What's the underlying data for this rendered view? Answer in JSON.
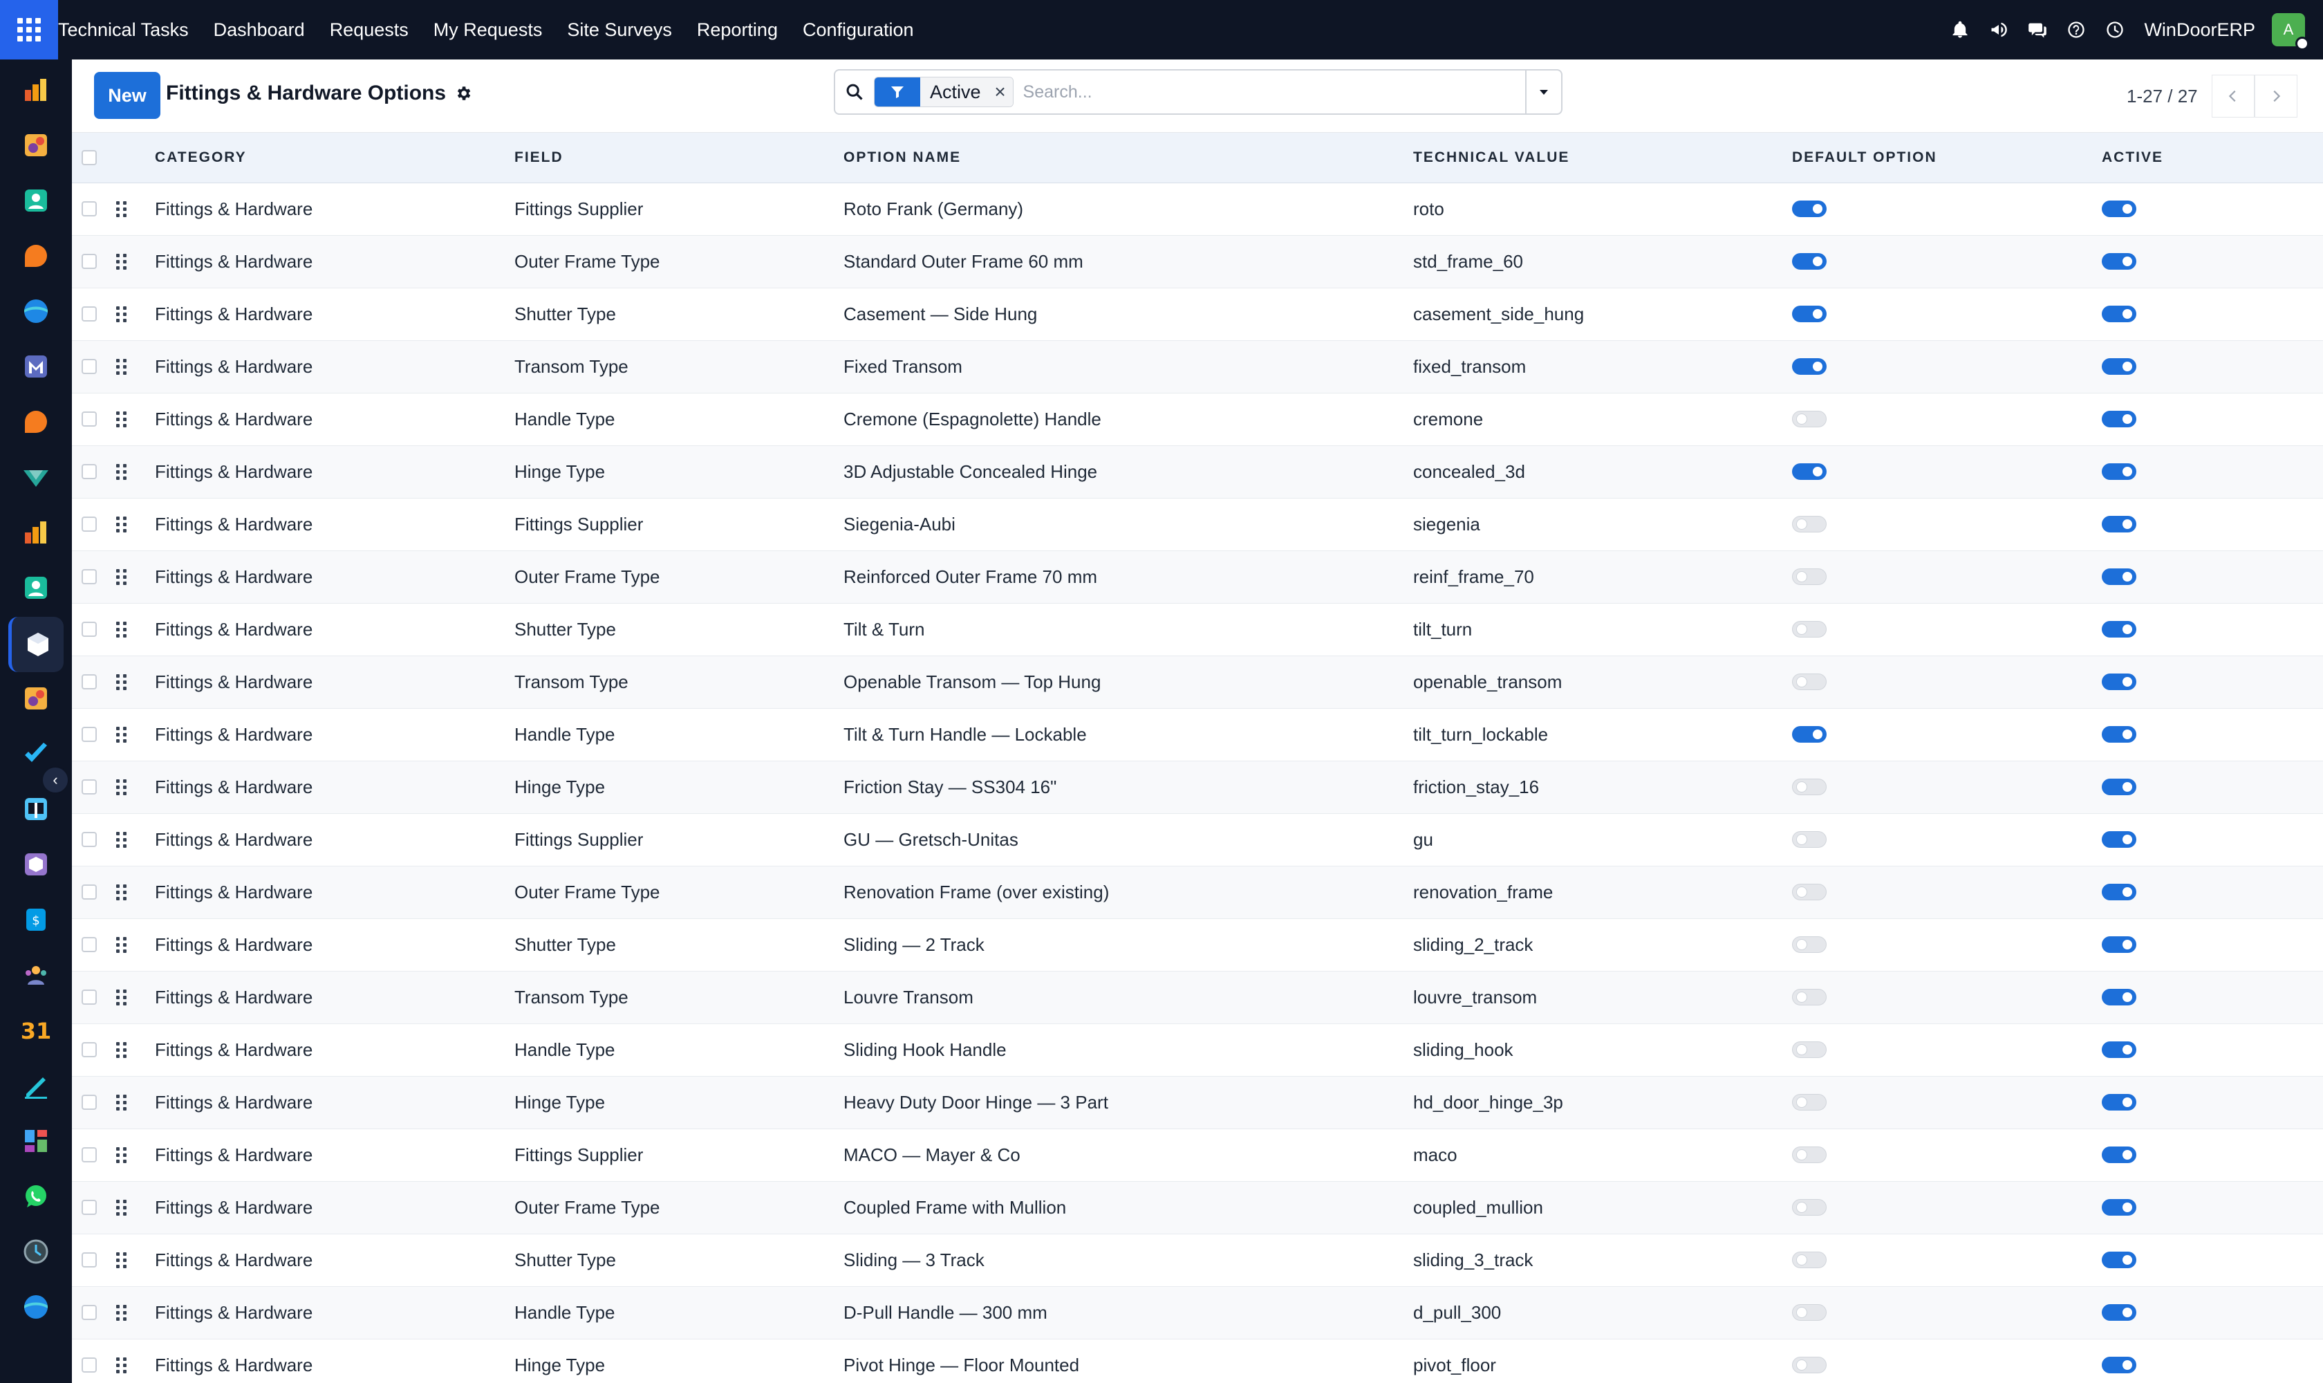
{
  "topbar": {
    "brand": "Technical Tasks",
    "menu": [
      "Dashboard",
      "Requests",
      "My Requests",
      "Site Surveys",
      "Reporting",
      "Configuration"
    ],
    "company": "WinDoorERP",
    "avatar_letter": "A",
    "icons": [
      "bell-icon",
      "megaphone-icon",
      "chat-icon",
      "help-icon",
      "clock-icon"
    ]
  },
  "appbar": {
    "icons": [
      "chart-app-icon",
      "puzzle-app-icon",
      "contacts-app-icon",
      "chat-bubble-app-icon",
      "sphere-app-icon",
      "mail-app-icon",
      "chat-bubble-app-icon",
      "arrow-app-icon",
      "chart-app-icon",
      "contacts-app-icon",
      "cube-app-icon",
      "puzzle-app-icon",
      "check-app-icon",
      "book-app-icon",
      "box-app-icon",
      "invoice-app-icon",
      "team-app-icon",
      "calendar-app-icon",
      "sign-app-icon",
      "dashboard-app-icon",
      "whatsapp-app-icon",
      "time-app-icon",
      "sphere-app-icon"
    ]
  },
  "control": {
    "new_label": "New",
    "title": "Fittings & Hardware Options",
    "facet_value": "Active",
    "search_placeholder": "Search...",
    "pager": "1-27 / 27"
  },
  "table": {
    "headers": {
      "category": "CATEGORY",
      "field": "FIELD",
      "option_name": "OPTION NAME",
      "technical_value": "TECHNICAL VALUE",
      "default_option": "DEFAULT OPTION",
      "active": "ACTIVE"
    },
    "rows": [
      {
        "category": "Fittings & Hardware",
        "field": "Fittings Supplier",
        "option": "Roto Frank (Germany)",
        "value": "roto",
        "default": true,
        "active": true
      },
      {
        "category": "Fittings & Hardware",
        "field": "Outer Frame Type",
        "option": "Standard Outer Frame 60 mm",
        "value": "std_frame_60",
        "default": true,
        "active": true
      },
      {
        "category": "Fittings & Hardware",
        "field": "Shutter Type",
        "option": "Casement — Side Hung",
        "value": "casement_side_hung",
        "default": true,
        "active": true
      },
      {
        "category": "Fittings & Hardware",
        "field": "Transom Type",
        "option": "Fixed Transom",
        "value": "fixed_transom",
        "default": true,
        "active": true
      },
      {
        "category": "Fittings & Hardware",
        "field": "Handle Type",
        "option": "Cremone (Espagnolette) Handle",
        "value": "cremone",
        "default": false,
        "active": true
      },
      {
        "category": "Fittings & Hardware",
        "field": "Hinge Type",
        "option": "3D Adjustable Concealed Hinge",
        "value": "concealed_3d",
        "default": true,
        "active": true
      },
      {
        "category": "Fittings & Hardware",
        "field": "Fittings Supplier",
        "option": "Siegenia-Aubi",
        "value": "siegenia",
        "default": false,
        "active": true
      },
      {
        "category": "Fittings & Hardware",
        "field": "Outer Frame Type",
        "option": "Reinforced Outer Frame 70 mm",
        "value": "reinf_frame_70",
        "default": false,
        "active": true
      },
      {
        "category": "Fittings & Hardware",
        "field": "Shutter Type",
        "option": "Tilt & Turn",
        "value": "tilt_turn",
        "default": false,
        "active": true
      },
      {
        "category": "Fittings & Hardware",
        "field": "Transom Type",
        "option": "Openable Transom — Top Hung",
        "value": "openable_transom",
        "default": false,
        "active": true
      },
      {
        "category": "Fittings & Hardware",
        "field": "Handle Type",
        "option": "Tilt & Turn Handle — Lockable",
        "value": "tilt_turn_lockable",
        "default": true,
        "active": true
      },
      {
        "category": "Fittings & Hardware",
        "field": "Hinge Type",
        "option": "Friction Stay — SS304 16\"",
        "value": "friction_stay_16",
        "default": false,
        "active": true
      },
      {
        "category": "Fittings & Hardware",
        "field": "Fittings Supplier",
        "option": "GU — Gretsch-Unitas",
        "value": "gu",
        "default": false,
        "active": true
      },
      {
        "category": "Fittings & Hardware",
        "field": "Outer Frame Type",
        "option": "Renovation Frame (over existing)",
        "value": "renovation_frame",
        "default": false,
        "active": true
      },
      {
        "category": "Fittings & Hardware",
        "field": "Shutter Type",
        "option": "Sliding — 2 Track",
        "value": "sliding_2_track",
        "default": false,
        "active": true
      },
      {
        "category": "Fittings & Hardware",
        "field": "Transom Type",
        "option": "Louvre Transom",
        "value": "louvre_transom",
        "default": false,
        "active": true
      },
      {
        "category": "Fittings & Hardware",
        "field": "Handle Type",
        "option": "Sliding Hook Handle",
        "value": "sliding_hook",
        "default": false,
        "active": true
      },
      {
        "category": "Fittings & Hardware",
        "field": "Hinge Type",
        "option": "Heavy Duty Door Hinge — 3 Part",
        "value": "hd_door_hinge_3p",
        "default": false,
        "active": true
      },
      {
        "category": "Fittings & Hardware",
        "field": "Fittings Supplier",
        "option": "MACO — Mayer & Co",
        "value": "maco",
        "default": false,
        "active": true
      },
      {
        "category": "Fittings & Hardware",
        "field": "Outer Frame Type",
        "option": "Coupled Frame with Mullion",
        "value": "coupled_mullion",
        "default": false,
        "active": true
      },
      {
        "category": "Fittings & Hardware",
        "field": "Shutter Type",
        "option": "Sliding — 3 Track",
        "value": "sliding_3_track",
        "default": false,
        "active": true
      },
      {
        "category": "Fittings & Hardware",
        "field": "Handle Type",
        "option": "D-Pull Handle — 300 mm",
        "value": "d_pull_300",
        "default": false,
        "active": true
      },
      {
        "category": "Fittings & Hardware",
        "field": "Hinge Type",
        "option": "Pivot Hinge — Floor Mounted",
        "value": "pivot_floor",
        "default": false,
        "active": true
      }
    ]
  },
  "colors": {
    "navbar": "#0e1525",
    "accent": "#1d6fd9",
    "header_row": "#eef3fa"
  }
}
